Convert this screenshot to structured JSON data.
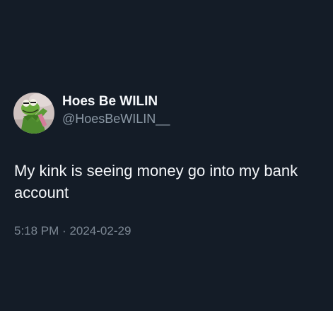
{
  "tweet": {
    "author": {
      "display_name": "Hoes Be WILIN",
      "handle": "@HoesBeWILIN__",
      "avatar_icon": "kermit-avatar-icon"
    },
    "text": "My kink is seeing money go into my bank account",
    "time": "5:18 PM",
    "separator": "·",
    "date": "2024-02-29"
  },
  "colors": {
    "background": "#141c27",
    "text": "#f5f7fa",
    "secondary_text": "#8b98a5"
  }
}
